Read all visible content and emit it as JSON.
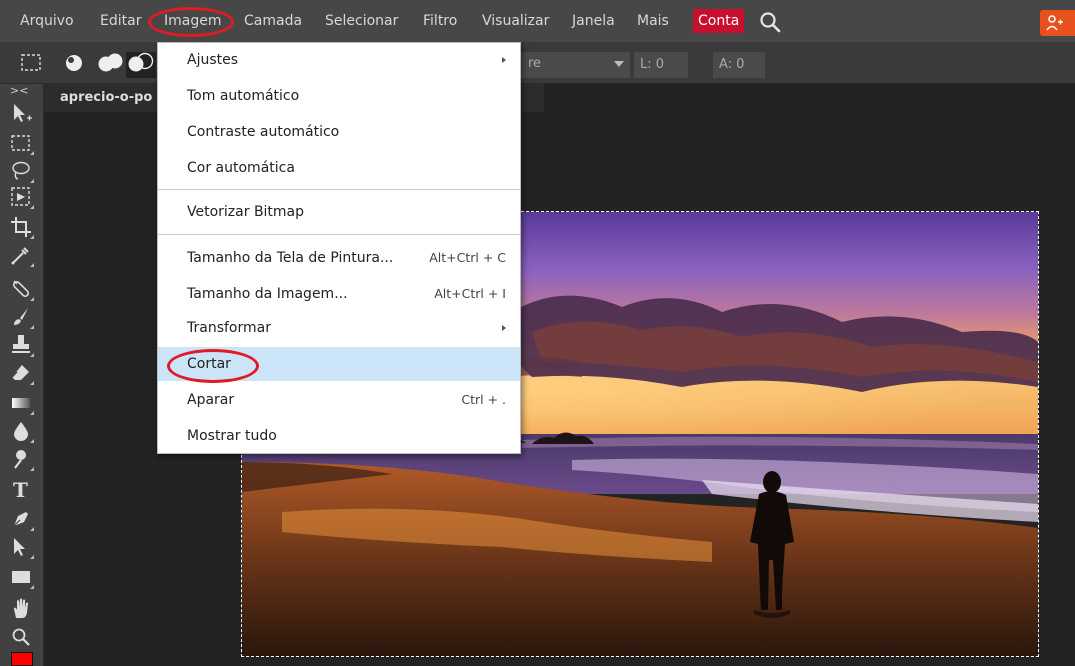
{
  "menubar": {
    "items": [
      {
        "label": "Arquivo"
      },
      {
        "label": "Editar"
      },
      {
        "label": "Imagem"
      },
      {
        "label": "Camada"
      },
      {
        "label": "Selecionar"
      },
      {
        "label": "Filtro"
      },
      {
        "label": "Visualizar"
      },
      {
        "label": "Janela"
      },
      {
        "label": "Mais"
      },
      {
        "label": "Conta"
      }
    ],
    "active_item": "Imagem",
    "highlight_color": "#e01b24",
    "conta_color": "#c8102e"
  },
  "options_bar": {
    "mode_value": "re",
    "width_label": "L: 0",
    "height_label": "A: 0"
  },
  "toolbar": {
    "collapse_label": "><",
    "tools": [
      "move-icon",
      "marquee-icon",
      "lasso-icon",
      "magic-wand-icon",
      "crop-icon",
      "eyedropper-icon",
      "healing-icon",
      "brush-icon",
      "stamp-icon",
      "eraser-icon",
      "gradient-icon",
      "blur-icon",
      "dodge-icon",
      "text-icon",
      "pen-icon",
      "path-select-icon",
      "shape-icon",
      "hand-icon",
      "zoom-icon"
    ],
    "foreground_color": "#ff0000"
  },
  "document": {
    "tab_name": "aprecio-o-po"
  },
  "image_menu": {
    "items": [
      {
        "label": "Ajustes",
        "shortcut": "",
        "submenu": true
      },
      {
        "label": "Tom automático",
        "shortcut": "",
        "submenu": false
      },
      {
        "label": "Contraste automático",
        "shortcut": "",
        "submenu": false
      },
      {
        "label": "Cor automática",
        "shortcut": "",
        "submenu": false
      },
      {
        "label": "Vetorizar Bitmap",
        "shortcut": "",
        "submenu": false
      },
      {
        "label": "Tamanho da Tela de Pintura...",
        "shortcut": "Alt+Ctrl + C",
        "submenu": false
      },
      {
        "label": "Tamanho da Imagem...",
        "shortcut": "Alt+Ctrl + I",
        "submenu": false
      },
      {
        "label": "Transformar",
        "shortcut": "",
        "submenu": true
      },
      {
        "label": "Cortar",
        "shortcut": "",
        "submenu": false
      },
      {
        "label": "Aparar",
        "shortcut": "Ctrl + .",
        "submenu": false
      },
      {
        "label": "Mostrar tudo",
        "shortcut": "",
        "submenu": false
      }
    ],
    "highlighted_item": "Cortar",
    "highlight_bg": "#cce4f7"
  }
}
